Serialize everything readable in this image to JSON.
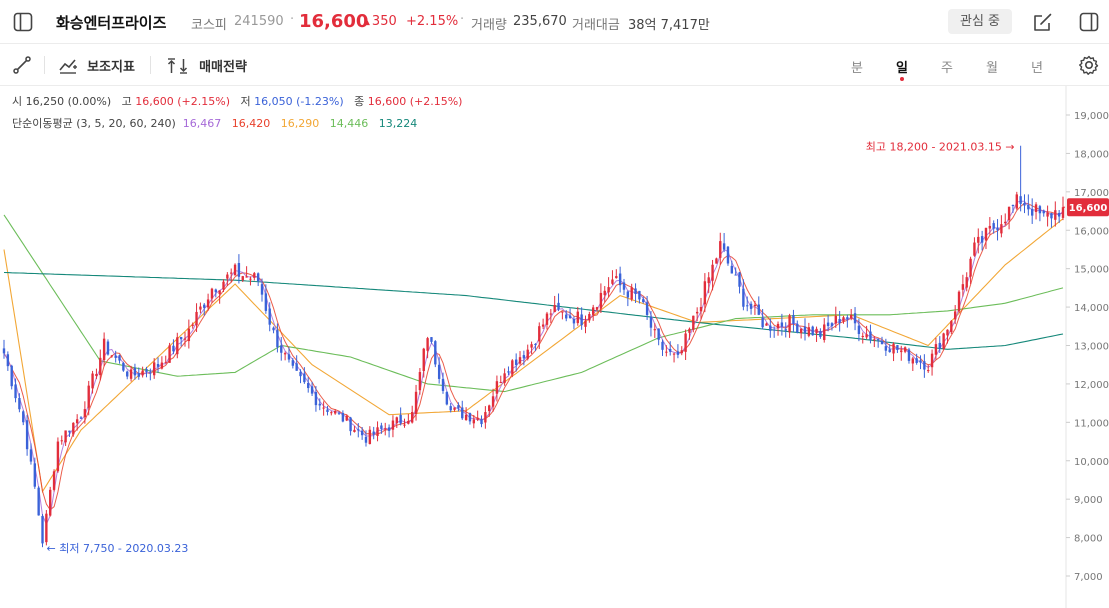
{
  "header": {
    "stock_name": "화승엔터프라이즈",
    "market": "코스피",
    "code": "241590",
    "price": "16,600",
    "change": "350",
    "change_pct": "+2.15%",
    "volume_label": "거래량",
    "volume": "235,670",
    "amount_label": "거래대금",
    "amount": "38억 7,417만",
    "watch_label": "관심 중"
  },
  "toolbar": {
    "indicators_label": "보조지표",
    "strategy_label": "매매전략",
    "periods": [
      "분",
      "일",
      "주",
      "월",
      "년"
    ],
    "active_period": "일"
  },
  "ohlc": {
    "open_label": "시",
    "open": "16,250 (0.00%)",
    "high_label": "고",
    "high": "16,600 (+2.15%)",
    "low_label": "저",
    "low": "16,050 (-1.23%)",
    "close_label": "종",
    "close": "16,600 (+2.15%)"
  },
  "ma": {
    "label": "단순이동평균 (3, 5, 20, 60, 240)",
    "values": [
      "16,467",
      "16,420",
      "16,290",
      "14,446",
      "13,224"
    ],
    "colors": [
      "#a66ad8",
      "#e8412c",
      "#f2a736",
      "#6cbd5a",
      "#15887a"
    ]
  },
  "colors": {
    "up": "#e22d3b",
    "down": "#3a62d8",
    "accent": "#e22d3b"
  },
  "chart_data": {
    "type": "candlestick",
    "y_ticks": [
      "19,000",
      "18,000",
      "17,000",
      "16,000",
      "15,000",
      "14,000",
      "13,000",
      "12,000",
      "11,000",
      "10,000",
      "9,000",
      "8,000",
      "7,000"
    ],
    "ylim": [
      6700,
      19700
    ],
    "high_annotation": "최고 18,200 - 2021.03.15 →",
    "high_value": 18200,
    "low_annotation": "← 최저 7,750 - 2020.03.23",
    "low_value": 7750,
    "current_price_label": "16,600",
    "current_price": 16600,
    "close_anchors": [
      [
        0,
        12800
      ],
      [
        5,
        11000
      ],
      [
        8,
        9300
      ],
      [
        10,
        7900
      ],
      [
        14,
        10500
      ],
      [
        20,
        11200
      ],
      [
        26,
        13000
      ],
      [
        33,
        12200
      ],
      [
        40,
        12500
      ],
      [
        48,
        13400
      ],
      [
        54,
        14500
      ],
      [
        60,
        14900
      ],
      [
        66,
        14700
      ],
      [
        70,
        13300
      ],
      [
        75,
        12300
      ],
      [
        82,
        11500
      ],
      [
        88,
        11100
      ],
      [
        94,
        10600
      ],
      [
        100,
        10900
      ],
      [
        106,
        11200
      ],
      [
        110,
        13300
      ],
      [
        116,
        11300
      ],
      [
        124,
        11100
      ],
      [
        130,
        12400
      ],
      [
        136,
        12900
      ],
      [
        142,
        13900
      ],
      [
        150,
        13700
      ],
      [
        158,
        14700
      ],
      [
        165,
        14200
      ],
      [
        170,
        13000
      ],
      [
        175,
        12600
      ],
      [
        180,
        13900
      ],
      [
        186,
        15600
      ],
      [
        192,
        14200
      ],
      [
        198,
        13500
      ],
      [
        204,
        13600
      ],
      [
        212,
        13300
      ],
      [
        218,
        13800
      ],
      [
        224,
        13300
      ],
      [
        232,
        12900
      ],
      [
        240,
        12500
      ],
      [
        246,
        13700
      ],
      [
        252,
        15500
      ],
      [
        258,
        16200
      ],
      [
        264,
        16800
      ],
      [
        270,
        16300
      ],
      [
        275,
        16600
      ]
    ],
    "ma_series": [
      {
        "period": 20,
        "points": [
          [
            0,
            15500
          ],
          [
            10,
            9200
          ],
          [
            20,
            10800
          ],
          [
            40,
            12700
          ],
          [
            60,
            14600
          ],
          [
            80,
            12500
          ],
          [
            100,
            11200
          ],
          [
            120,
            11300
          ],
          [
            140,
            12800
          ],
          [
            160,
            14300
          ],
          [
            180,
            13600
          ],
          [
            200,
            13700
          ],
          [
            220,
            13800
          ],
          [
            240,
            13000
          ],
          [
            260,
            15100
          ],
          [
            275,
            16300
          ]
        ]
      },
      {
        "period": 60,
        "points": [
          [
            0,
            16400
          ],
          [
            25,
            12600
          ],
          [
            45,
            12200
          ],
          [
            60,
            12300
          ],
          [
            72,
            13000
          ],
          [
            90,
            12700
          ],
          [
            110,
            12000
          ],
          [
            130,
            11800
          ],
          [
            150,
            12300
          ],
          [
            170,
            13200
          ],
          [
            190,
            13700
          ],
          [
            210,
            13800
          ],
          [
            230,
            13800
          ],
          [
            245,
            13900
          ],
          [
            260,
            14100
          ],
          [
            275,
            14500
          ]
        ]
      },
      {
        "period": 240,
        "points": [
          [
            0,
            14900
          ],
          [
            60,
            14700
          ],
          [
            120,
            14300
          ],
          [
            180,
            13600
          ],
          [
            220,
            13200
          ],
          [
            245,
            12900
          ],
          [
            260,
            13000
          ],
          [
            275,
            13300
          ]
        ]
      }
    ]
  }
}
